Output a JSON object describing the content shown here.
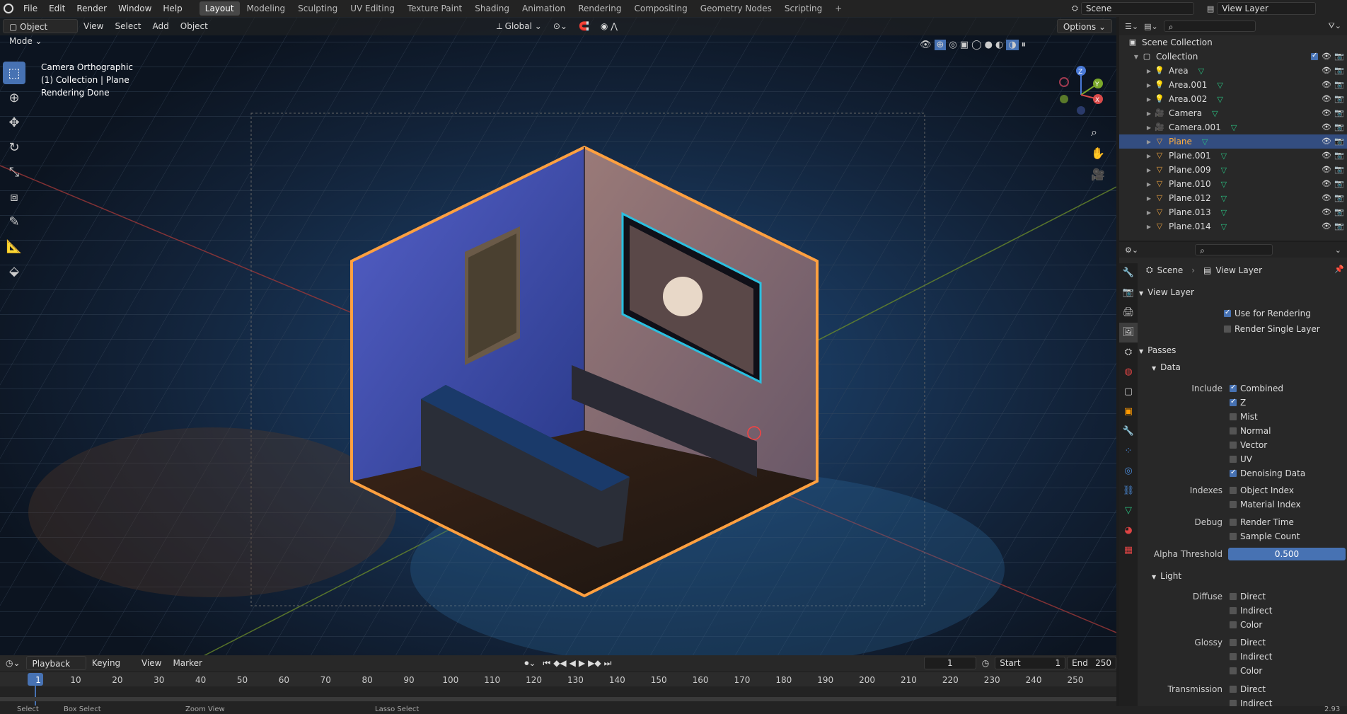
{
  "menus": [
    "File",
    "Edit",
    "Render",
    "Window",
    "Help"
  ],
  "workspaces": [
    "Layout",
    "Modeling",
    "Sculpting",
    "UV Editing",
    "Texture Paint",
    "Shading",
    "Animation",
    "Rendering",
    "Compositing",
    "Geometry Nodes",
    "Scripting"
  ],
  "active_workspace": "Layout",
  "scene": {
    "name": "Scene",
    "view_layer": "View Layer"
  },
  "viewport_header": {
    "mode": "Object Mode",
    "menus": [
      "View",
      "Select",
      "Add",
      "Object"
    ],
    "transform": "Global",
    "options": "Options"
  },
  "viewport_overlay": {
    "line1": "Camera Orthographic",
    "line2": "(1) Collection | Plane",
    "line3": "Rendering Done"
  },
  "gizmo": {
    "z": "Z",
    "y": "Y",
    "x": "X"
  },
  "outliner": {
    "root": "Scene Collection",
    "collection": "Collection",
    "items": [
      {
        "name": "Area",
        "type": "light"
      },
      {
        "name": "Area.001",
        "type": "light"
      },
      {
        "name": "Area.002",
        "type": "light"
      },
      {
        "name": "Camera",
        "type": "camera"
      },
      {
        "name": "Camera.001",
        "type": "camera"
      },
      {
        "name": "Plane",
        "type": "mesh",
        "selected": true
      },
      {
        "name": "Plane.001",
        "type": "mesh"
      },
      {
        "name": "Plane.009",
        "type": "mesh"
      },
      {
        "name": "Plane.010",
        "type": "mesh"
      },
      {
        "name": "Plane.012",
        "type": "mesh"
      },
      {
        "name": "Plane.013",
        "type": "mesh"
      },
      {
        "name": "Plane.014",
        "type": "mesh"
      }
    ]
  },
  "properties": {
    "breadcrumb_scene": "Scene",
    "breadcrumb_layer": "View Layer",
    "view_layer_title": "View Layer",
    "use_for_rendering": "Use for Rendering",
    "render_single_layer": "Render Single Layer",
    "passes_title": "Passes",
    "data_title": "Data",
    "include_label": "Include",
    "combined": "Combined",
    "z": "Z",
    "mist": "Mist",
    "normal": "Normal",
    "vector": "Vector",
    "uv": "UV",
    "denoising": "Denoising Data",
    "indexes_label": "Indexes",
    "object_index": "Object Index",
    "material_index": "Material Index",
    "debug_label": "Debug",
    "render_time": "Render Time",
    "sample_count": "Sample Count",
    "alpha_label": "Alpha Threshold",
    "alpha_value": "0.500",
    "light_title": "Light",
    "diffuse_label": "Diffuse",
    "glossy_label": "Glossy",
    "transmission_label": "Transmission",
    "direct": "Direct",
    "indirect": "Indirect",
    "color": "Color"
  },
  "timeline": {
    "menus": [
      "Playback",
      "Keying",
      "View",
      "Marker"
    ],
    "current_frame": "1",
    "start_label": "Start",
    "start": "1",
    "end_label": "End",
    "end": "250",
    "ticks": [
      "1",
      "10",
      "20",
      "30",
      "40",
      "50",
      "60",
      "70",
      "80",
      "90",
      "100",
      "110",
      "120",
      "130",
      "140",
      "150",
      "160",
      "170",
      "180",
      "190",
      "200",
      "210",
      "220",
      "230",
      "240",
      "250"
    ]
  },
  "statusbar": {
    "select": "Select",
    "box_select": "Box Select",
    "zoom_view": "Zoom View",
    "lasso_select": "Lasso Select",
    "version": "2.93"
  },
  "colors": {
    "accent": "#4772b3",
    "selected_text": "#ffae3d",
    "header": "#232323",
    "panel": "#282828"
  }
}
